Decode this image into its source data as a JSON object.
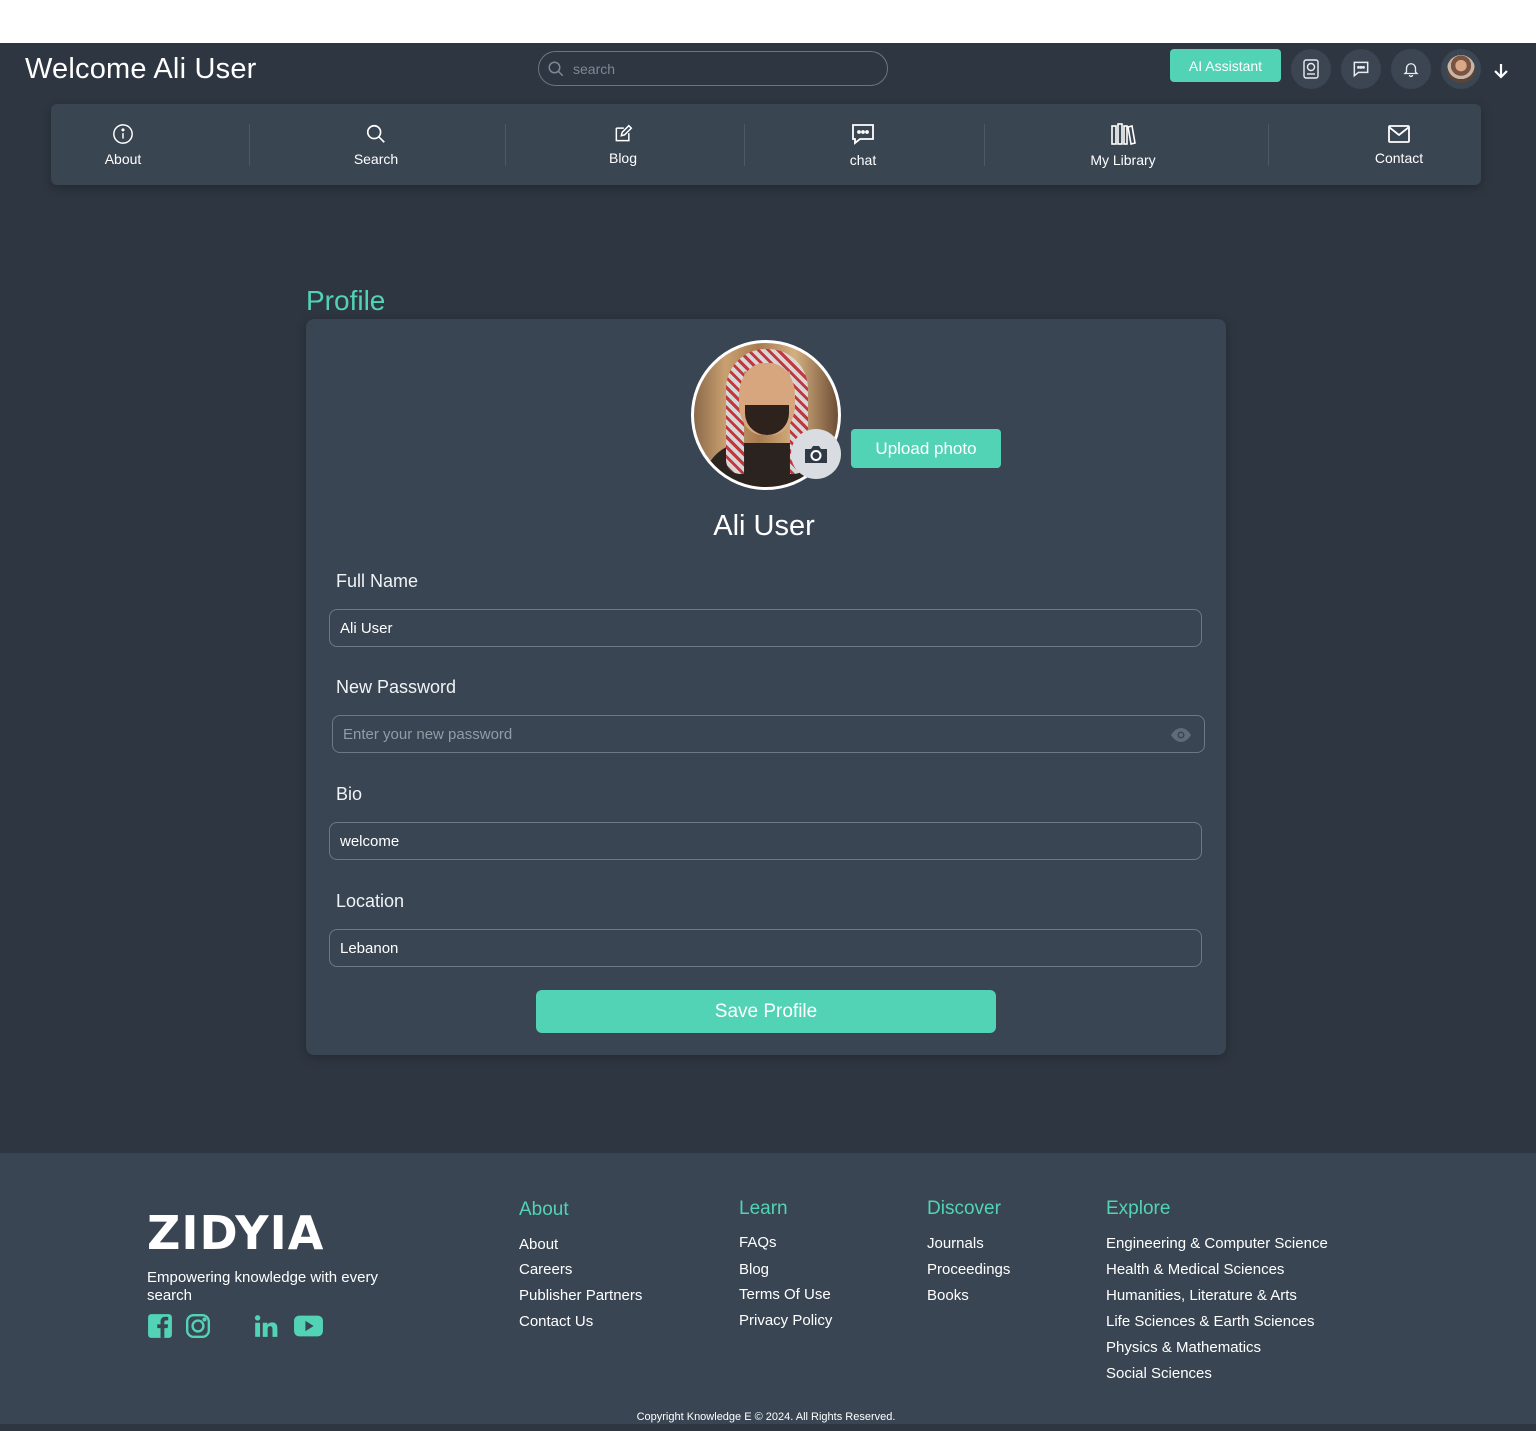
{
  "header": {
    "welcome": "Welcome Ali User",
    "search_placeholder": "search",
    "ai_button": "AI Assistant",
    "icons": [
      "chat-bot-icon",
      "message-icon",
      "bell-icon",
      "avatar",
      "arrow-down-icon"
    ]
  },
  "nav": {
    "items": [
      {
        "label": "About",
        "icon": "info-icon"
      },
      {
        "label": "Search",
        "icon": "search-icon"
      },
      {
        "label": "Blog",
        "icon": "edit-icon"
      },
      {
        "label": "chat",
        "icon": "chat-icon"
      },
      {
        "label": "My Library",
        "icon": "library-icon"
      },
      {
        "label": "Contact",
        "icon": "mail-icon"
      }
    ]
  },
  "profile": {
    "heading": "Profile",
    "upload_button": "Upload photo",
    "display_name": "Ali User",
    "fields": {
      "full_name": {
        "label": "Full Name",
        "value": "Ali User"
      },
      "new_password": {
        "label": "New Password",
        "placeholder": "Enter your new password"
      },
      "bio": {
        "label": "Bio",
        "value": "welcome"
      },
      "location": {
        "label": "Location",
        "value": "Lebanon"
      }
    },
    "save_button": "Save Profile"
  },
  "footer": {
    "brand": "ZIDYIA",
    "tagline": "Empowering knowledge with every search",
    "social": [
      "facebook-icon",
      "instagram-icon",
      "linkedin-icon",
      "youtube-icon"
    ],
    "columns": [
      {
        "title": "About",
        "links": [
          "About",
          "Careers",
          "Publisher Partners",
          "Contact Us"
        ]
      },
      {
        "title": "Learn",
        "links": [
          "FAQs",
          "Blog",
          "Terms Of Use",
          "Privacy Policy"
        ]
      },
      {
        "title": "Discover",
        "links": [
          "Journals",
          "Proceedings",
          "Books"
        ]
      },
      {
        "title": "Explore",
        "links": [
          "Engineering & Computer Science",
          "Health & Medical Sciences",
          "Humanities, Literature & Arts",
          "Life Sciences & Earth Sciences",
          "Physics & Mathematics",
          "Social Sciences"
        ]
      }
    ],
    "copyright": "Copyright Knowledge E © 2024. All Rights Reserved."
  },
  "colors": {
    "accent": "#52d3b6",
    "background": "#2e3641",
    "panel": "#394552"
  }
}
